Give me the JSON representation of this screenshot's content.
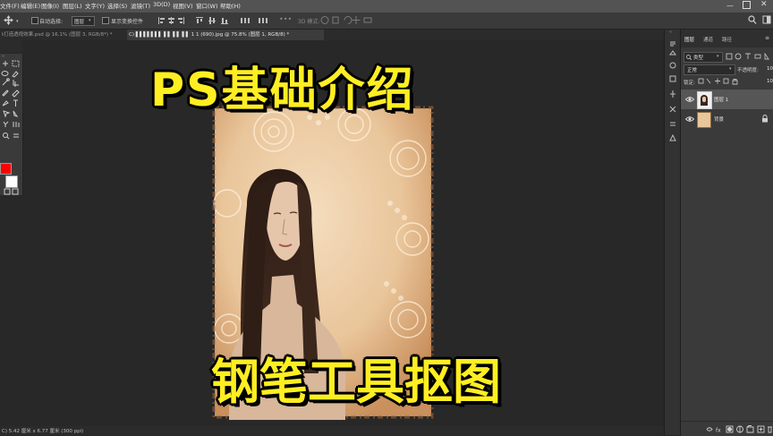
{
  "menu": [
    "文件(F)",
    "编辑(E)",
    "图像(I)",
    "图层(L)",
    "文字(Y)",
    "选择(S)",
    "滤镜(T)",
    "3D(D)",
    "视图(V)",
    "窗口(W)",
    "帮助(H)"
  ],
  "options": {
    "auto_select_label": "自动选择:",
    "auto_select_value": "图层",
    "transform_label": "显示变换控件",
    "mode_3d_label": "3D 模式:"
  },
  "tabs": [
    {
      "label": "t打造透视效果.psd @ 16.1% (图层 3, RGB/8*) *",
      "active": false
    },
    {
      "label": "C) ▌▌▌▌▌▌▌ ▌▌ ▌▌ ▌▌ 1 1 (690).jpg @ 75.8% (图层 1, RGB/8) *",
      "active": true
    }
  ],
  "overlay": {
    "title_top": "PS基础介绍",
    "title_bottom": "钢笔工具抠图"
  },
  "layers_panel": {
    "tabs": [
      "图层",
      "通道",
      "路径"
    ],
    "filter_label": "类型",
    "blend_mode": "正常",
    "opacity_label": "不透明度:",
    "opacity_value": "100",
    "lock_label": "锁定:",
    "fill_value": "100",
    "layers": [
      {
        "name": "图层 1",
        "selected": true,
        "visible": true
      },
      {
        "name": "背景",
        "selected": false,
        "visible": true
      }
    ]
  },
  "status": {
    "text": "C) 5.42 厘米 x 6.77 厘米 (300 ppi)"
  },
  "colors": {
    "foreground": "#ff0000",
    "background": "#ffffff",
    "overlay_text": "#ffee22"
  },
  "icons": [
    "ps-logo-icon",
    "move-tool-icon",
    "marquee-tool-icon",
    "lasso-tool-icon",
    "quick-select-icon",
    "crop-tool-icon",
    "eyedropper-icon",
    "brush-tool-icon",
    "eraser-icon",
    "pen-tool-icon",
    "type-tool-icon",
    "path-select-icon",
    "shape-tool-icon",
    "hand-tool-icon",
    "zoom-tool-icon",
    "search-icon",
    "eye-icon",
    "lock-icon"
  ]
}
